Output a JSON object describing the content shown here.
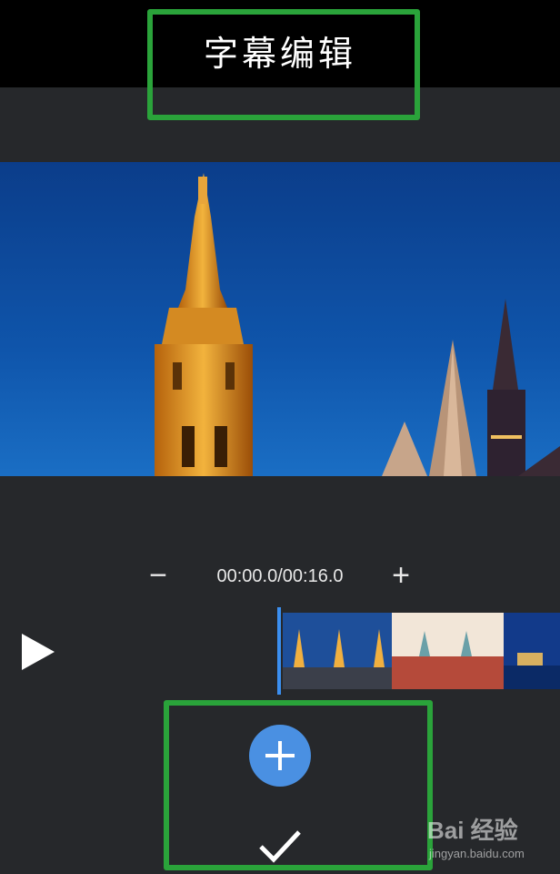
{
  "header": {
    "title": "字幕编辑"
  },
  "timeline": {
    "time_display": "00:00.0/00:16.0",
    "zoom_out_label": "−",
    "zoom_in_label": "+"
  },
  "icons": {
    "play": "play-icon",
    "add": "plus-icon",
    "confirm": "checkmark-icon"
  },
  "colors": {
    "highlight": "#2aa33a",
    "accent": "#4a90e2",
    "playhead": "#3b8ff0",
    "background": "#26282b"
  },
  "watermark": {
    "brand": "Bai 经验",
    "url": "jingyan.baidu.com"
  }
}
